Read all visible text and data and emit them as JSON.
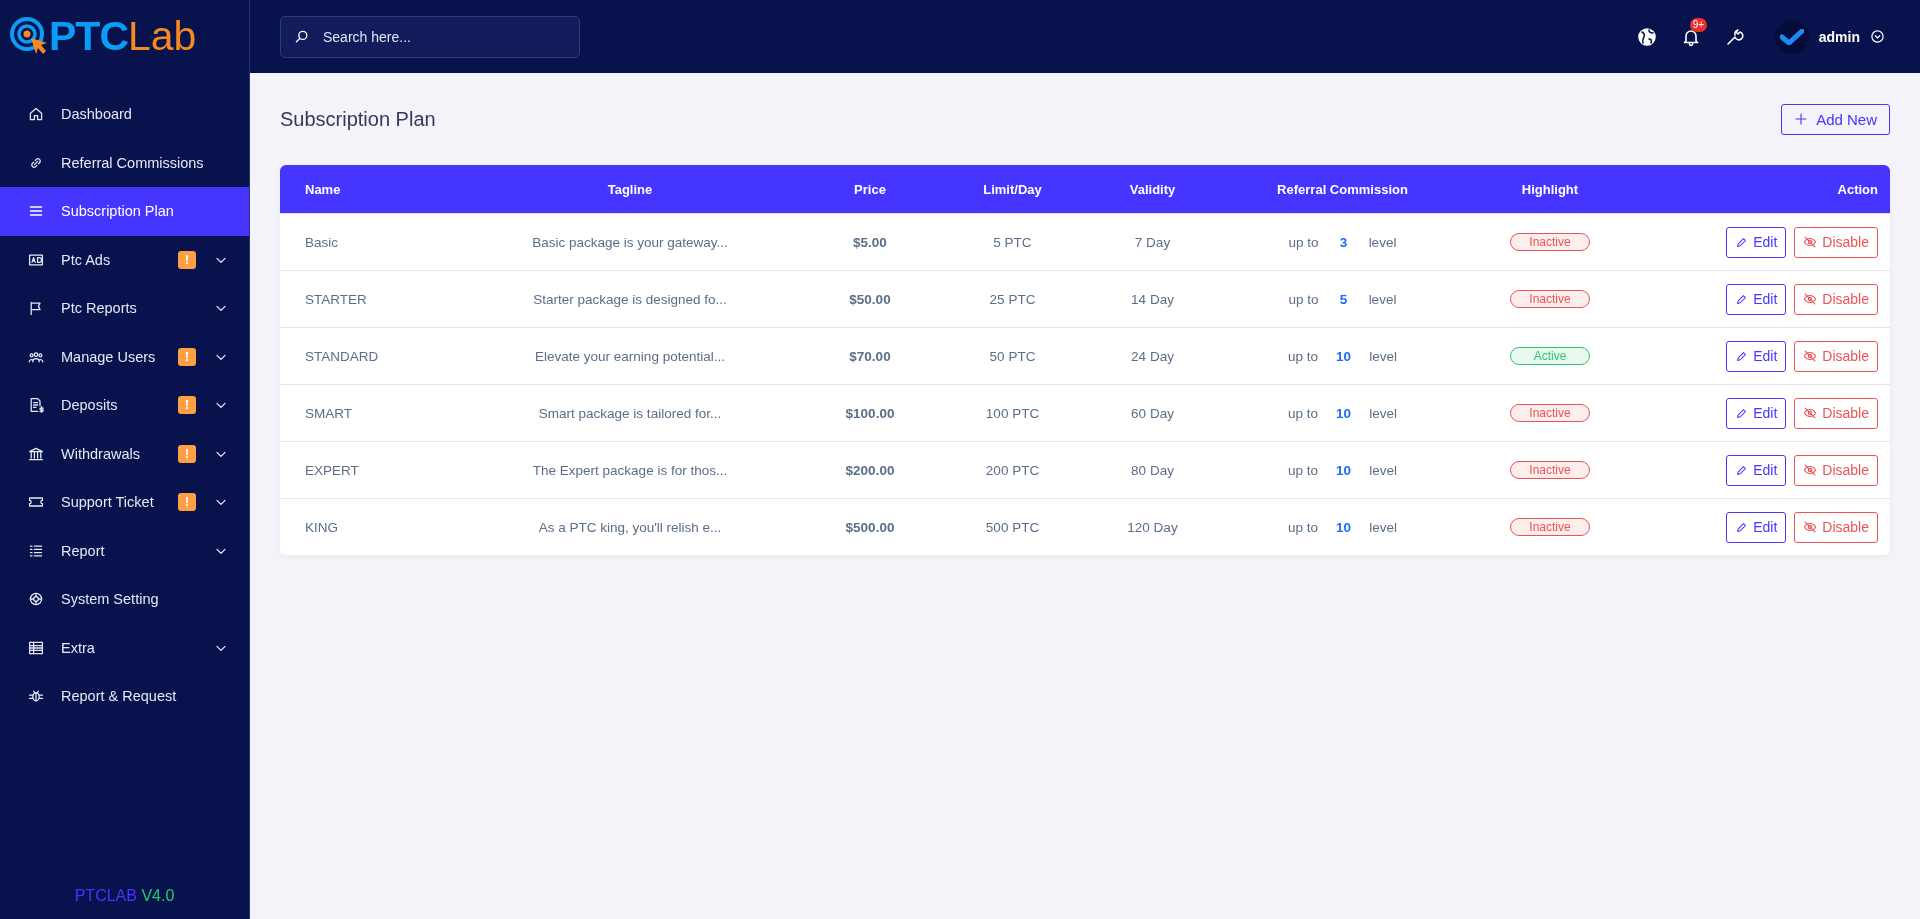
{
  "sidebar": {
    "logo": {
      "primary": "PTC",
      "secondary": "Lab"
    },
    "items": [
      {
        "label": "Dashboard",
        "selected": false,
        "expandable": false
      },
      {
        "label": "Referral Commissions",
        "selected": false,
        "expandable": false
      },
      {
        "label": "Subscription Plan",
        "selected": true,
        "expandable": false
      },
      {
        "label": "Ptc Ads",
        "selected": false,
        "alert": "!",
        "expandable": true
      },
      {
        "label": "Ptc Reports",
        "selected": false,
        "expandable": true
      },
      {
        "label": "Manage Users",
        "selected": false,
        "alert": "!",
        "expandable": true
      },
      {
        "label": "Deposits",
        "selected": false,
        "alert": "!",
        "expandable": true
      },
      {
        "label": "Withdrawals",
        "selected": false,
        "alert": "!",
        "expandable": true
      },
      {
        "label": "Support Ticket",
        "selected": false,
        "alert": "!",
        "expandable": true
      },
      {
        "label": "Report",
        "selected": false,
        "expandable": true
      },
      {
        "label": "System Setting",
        "selected": false,
        "expandable": false
      },
      {
        "label": "Extra",
        "selected": false,
        "expandable": true
      },
      {
        "label": "Report & Request",
        "selected": false,
        "expandable": false
      }
    ],
    "version": {
      "name": "PTCLAB",
      "number": "V4.0"
    }
  },
  "header": {
    "search": {
      "placeholder": "Search here..."
    },
    "notification_count": "9+",
    "user": "admin"
  },
  "page": {
    "title": "Subscription Plan",
    "add_button": "Add New"
  },
  "table": {
    "columns": [
      "Name",
      "Tagline",
      "Price",
      "Limit/Day",
      "Validity",
      "Referral Commission",
      "Highlight",
      "Action"
    ],
    "rows": [
      {
        "name": "Basic",
        "tagline": "Basic package is your gateway...",
        "price": "$5.00",
        "limit": "5 PTC",
        "validity": "7 Day",
        "commission": {
          "prefix": "up to",
          "levels": "3",
          "suffix": "level"
        },
        "highlight": {
          "label": "Inactive",
          "active": false
        },
        "actions": [
          "Edit",
          "Disable"
        ]
      },
      {
        "name": "STARTER",
        "tagline": "Starter package is designed fo...",
        "price": "$50.00",
        "limit": "25 PTC",
        "validity": "14 Day",
        "commission": {
          "prefix": "up to",
          "levels": "5",
          "suffix": "level"
        },
        "highlight": {
          "label": "Inactive",
          "active": false
        },
        "actions": [
          "Edit",
          "Disable"
        ]
      },
      {
        "name": "STANDARD",
        "tagline": "Elevate your earning potential...",
        "price": "$70.00",
        "limit": "50 PTC",
        "validity": "24 Day",
        "commission": {
          "prefix": "up to",
          "levels": "10",
          "suffix": "level"
        },
        "highlight": {
          "label": "Active",
          "active": true
        },
        "actions": [
          "Edit",
          "Disable"
        ]
      },
      {
        "name": "SMART",
        "tagline": "Smart package is tailored for...",
        "price": "$100.00",
        "limit": "100 PTC",
        "validity": "60 Day",
        "commission": {
          "prefix": "up to",
          "levels": "10",
          "suffix": "level"
        },
        "highlight": {
          "label": "Inactive",
          "active": false
        },
        "actions": [
          "Edit",
          "Disable"
        ]
      },
      {
        "name": "EXPERT",
        "tagline": "The Expert package is for thos...",
        "price": "$200.00",
        "limit": "200 PTC",
        "validity": "80 Day",
        "commission": {
          "prefix": "up to",
          "levels": "10",
          "suffix": "level"
        },
        "highlight": {
          "label": "Inactive",
          "active": false
        },
        "actions": [
          "Edit",
          "Disable"
        ]
      },
      {
        "name": "KING",
        "tagline": "As a PTC king, you'll relish e...",
        "price": "$500.00",
        "limit": "500 PTC",
        "validity": "120 Day",
        "commission": {
          "prefix": "up to",
          "levels": "10",
          "suffix": "level"
        },
        "highlight": {
          "label": "Inactive",
          "active": false
        },
        "actions": [
          "Edit",
          "Disable"
        ]
      }
    ]
  }
}
